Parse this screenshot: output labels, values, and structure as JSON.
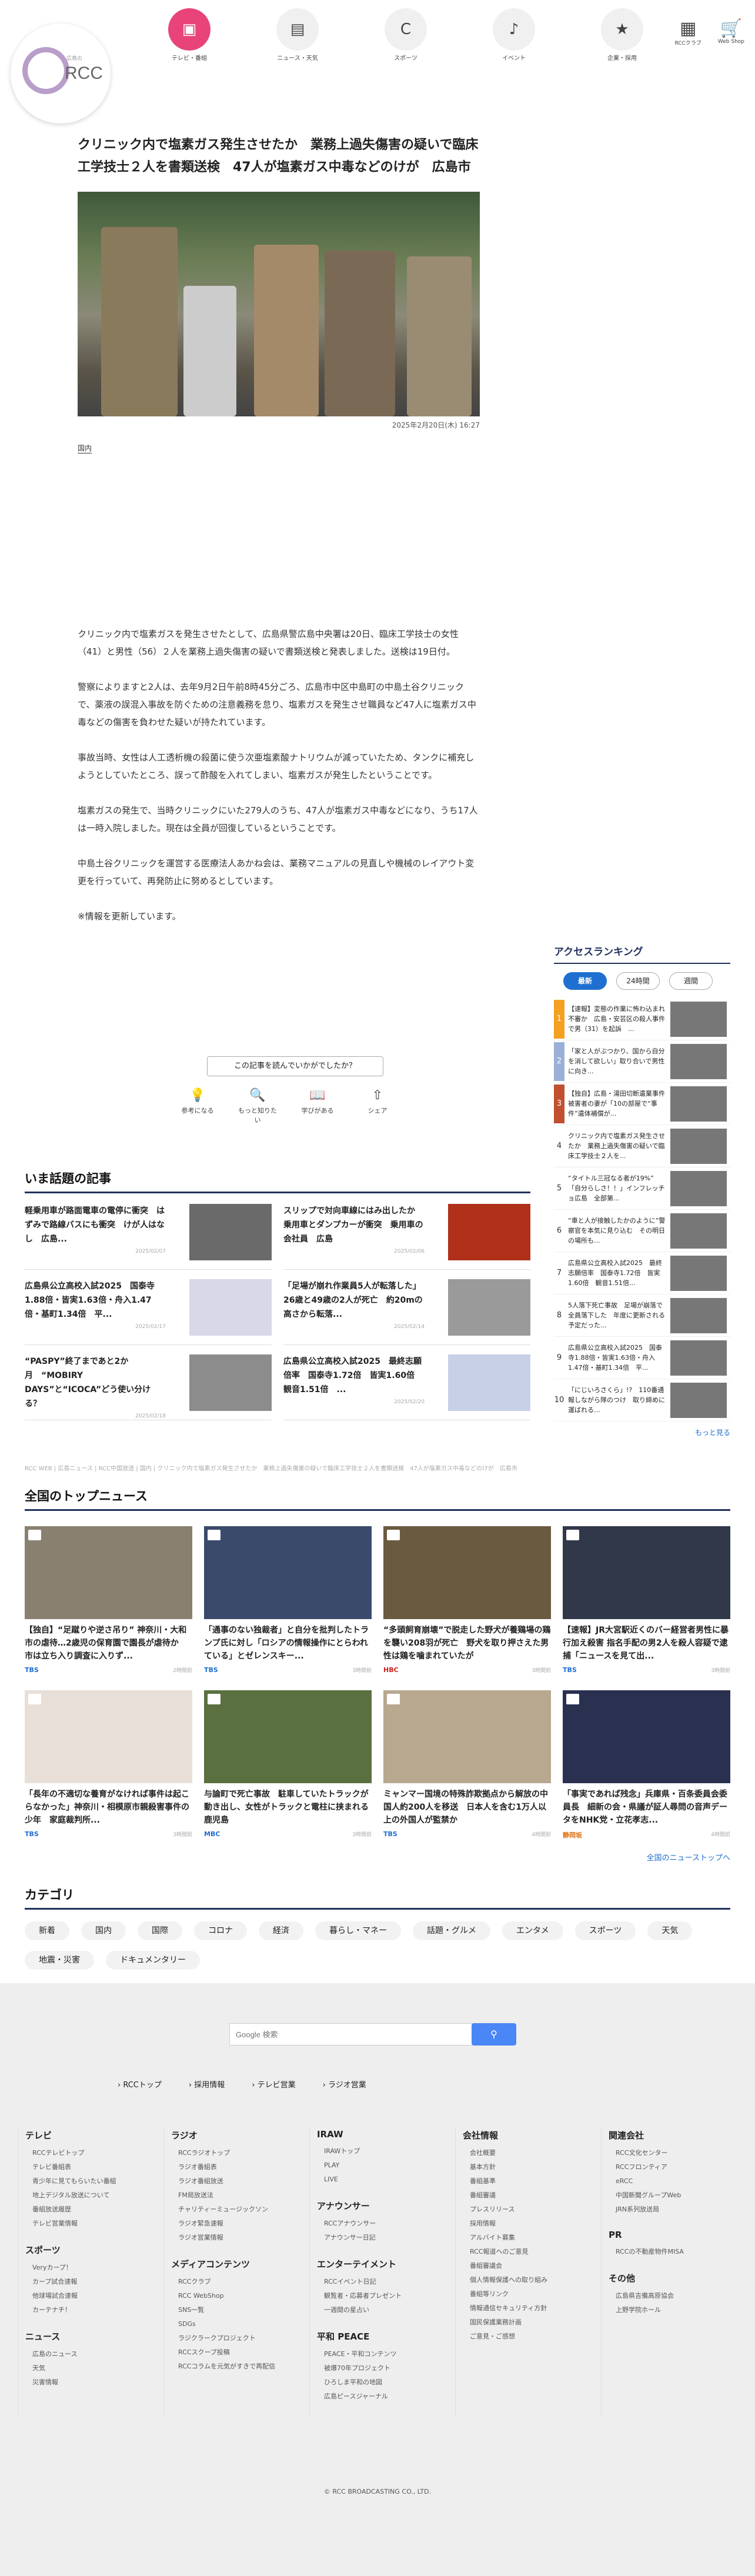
{
  "logo": {
    "sub": "広島の",
    "name": "RCC"
  },
  "nav": [
    {
      "label": "テレビ・番組",
      "icon": "tv-icon",
      "g": "▣"
    },
    {
      "label": "ニュース・天気",
      "icon": "news-icon",
      "g": "▤"
    },
    {
      "label": "スポーツ",
      "icon": "carp-icon",
      "g": "C"
    },
    {
      "label": "イベント",
      "icon": "music-note-icon",
      "g": "♪"
    },
    {
      "label": "企業・採用",
      "icon": "star-icon",
      "g": "★"
    }
  ],
  "util": [
    {
      "label": "RCCクラブ",
      "icon": "grid-icon",
      "g": "▦"
    },
    {
      "label": "Web Shop",
      "icon": "cart-icon",
      "g": "🛒"
    }
  ],
  "article": {
    "title": "クリニック内で塩素ガス発生させたか　業務上過失傷害の疑いで臨床工学技士２人を書類送検　47人が塩素ガス中毒などのけが　広島市",
    "date": "2025年2月20日(木) 16:27",
    "category": "国内",
    "paragraphs": [
      "クリニック内で塩素ガスを発生させたとして、広島県警広島中央署は20日、臨床工学技士の女性（41）と男性（56）２人を業務上過失傷害の疑いで書類送検と発表しました。送検は19日付。",
      "警察によりますと2人は、去年9月2日午前8時45分ごろ、広島市中区中島町の中島土谷クリニックで、薬液の誤混入事故を防ぐための注意義務を怠り、塩素ガスを発生させ職員など47人に塩素ガス中毒などの傷害を負わせた疑いが持たれています。",
      "事故当時、女性は人工透析機の殺菌に使う次亜塩素酸ナトリウムが減っていたため、タンクに補充しようとしていたところ、誤って酢酸を入れてしまい、塩素ガスが発生したということです。",
      "塩素ガスの発生で、当時クリニックにいた279人のうち、47人が塩素ガス中毒などになり、うち17人は一時入院しました。現在は全員が回復しているということです。",
      "中島土谷クリニックを運営する医療法人あかね会は、業務マニュアルの見直しや機械のレイアウト変更を行っていて、再発防止に努めるとしています。",
      "※情報を更新しています。"
    ],
    "ask": "この記事を読んでいかがでしたか？",
    "reactions": [
      {
        "label": "参考になる",
        "g": "💡"
      },
      {
        "label": "もっと知りたい",
        "g": "🔍"
      },
      {
        "label": "学びがある",
        "g": "📖"
      },
      {
        "label": "シェア",
        "g": "⇧"
      }
    ]
  },
  "wadai": {
    "title": "いま話題の記事",
    "items": [
      {
        "title": "軽乗用車が路面電車の電停に衝突　はずみで路線バスにも衝突　けが人はなし　広島...",
        "date": "2025/02/07"
      },
      {
        "title": "スリップで対向車線にはみ出したか　乗用車とダンプカーが衝突　乗用車の会社員　広島",
        "date": "2025/02/06"
      },
      {
        "title": "広島県公立高校入試2025　国泰寺1.88倍・皆実1.63倍・舟入1.47倍・基町1.34倍　平...",
        "date": "2025/02/17"
      },
      {
        "title": "「足場が崩れ作業員5人が転落した」26歳と49歳の2人が死亡　約20mの高さから転落...",
        "date": "2025/02/14"
      },
      {
        "title": "“PASPY”終了まであと2か月　“MOBIRY DAYS”と“ICOCA”どう使い分ける？",
        "date": "2025/02/18"
      },
      {
        "title": "広島県公立高校入試2025　最終志願倍率　国泰寺1.72倍　皆実1.60倍　観音1.51倍　...",
        "date": "2025/02/20"
      }
    ]
  },
  "crumb": "RCC WEB | 広島ニュース | RCC中国放送 | 国内 | クリニック内で塩素ガス発生させたか　業務上過失傷害の疑いで臨床工学技士２人を書類送検　47人が塩素ガス中毒などのけが　広島市",
  "ranking": {
    "title": "アクセスランキング",
    "tabs": [
      "最新",
      "24時間",
      "週間"
    ],
    "items": [
      {
        "n": "1",
        "title": "【速報】変態の作業に怖わ込まれ不審か　広島・安芸区の殺人事件で男（31）を起訴　..."
      },
      {
        "n": "2",
        "title": "「家と人がぶつかり、国から自分を消して欲しい」取り合いで男性に向き..."
      },
      {
        "n": "3",
        "title": "【独自】広島・湯田切断遺棄事件　被害者の妻が「10の部屋で“事件”遺体補償が..."
      },
      {
        "n": "4",
        "title": "クリニック内で塩素ガス発生させたか　業務上過失傷害の疑いで臨床工学技士２人を..."
      },
      {
        "n": "5",
        "title": "“タイトル三冠なる者が19%” 「自分らしさ！！」インフレッチョ広島　全部第..."
      },
      {
        "n": "6",
        "title": "“車と人が接触したかのように”警察官を本気に見り込む　その明日の場所も..."
      },
      {
        "n": "7",
        "title": "広島県公立高校入試2025　最終志願倍率　国泰寺1.72倍　皆実1.60倍　観音1.51倍..."
      },
      {
        "n": "8",
        "title": "5人落下死亡事故　足場が崩落で全員落下した　年度に更新される予定だった..."
      },
      {
        "n": "9",
        "title": "広島県公立高校入試2025　国泰寺1.88倍・皆実1.63倍・舟入1.47倍・基町1.34倍　平..."
      },
      {
        "n": "10",
        "title": "「にじいろさくら」!?　110番通報しながら隊のつけ　取り締めに運ばれる..."
      }
    ],
    "more": "もっと見る"
  },
  "top": {
    "title": "全国のトップニュース",
    "items": [
      {
        "title": "【独自】“足蹴りや逆さ吊り” 神奈川・大和市の虐待…2歳児の保育園で園長が虐待か　市は立ち入り調査に入りず...",
        "src": "TBS",
        "date": "2時間前"
      },
      {
        "title": "「通事のない独裁者」と自分を批判したトランプ氏に対し「ロシアの情報操作にとらわれている」とゼレンスキー...",
        "src": "TBS",
        "date": "3時間前"
      },
      {
        "title": "“多頭飼育崩壊”で脱走した野犬が養鶏場の鶏を襲い208羽が死亡　野犬を取り押さえた男性は鶏を噛まれていたが",
        "src": "HBC",
        "date": "3時間前"
      },
      {
        "title": "【速報】JR大宮駅近くのバー経営者男性に暴行加え殺害 指名手配の男2人を殺人容疑で逮捕「ニュースを見て出...",
        "src": "TBS",
        "date": "3時間前"
      },
      {
        "title": "「長年の不適切な養育がなければ事件は起こらなかった」神奈川・相模原市親殺害事件の少年　家庭裁判所...",
        "src": "TBS",
        "date": "3時間前"
      },
      {
        "title": "与論町で死亡事故　駐車していたトラックが動き出し、女性がトラックと電柱に挟まれる　鹿児島",
        "src": "MBC",
        "date": "3時間前"
      },
      {
        "title": "ミャンマー国境の特殊詐欺拠点から解放の中国人約200人を移送　日本人を含む1万人以上の外国人が監禁か",
        "src": "TBS",
        "date": "4時間前"
      },
      {
        "title": "「事実であれば残念」兵庫県・百条委員会委員長　細新の会・県議が証人尋問の音声データをNHK党・立花孝志...",
        "src": "静岡坂",
        "date": "4時間前"
      }
    ],
    "more": "全国のニューストップへ"
  },
  "category": {
    "title": "カテゴリ",
    "chips": [
      "新着",
      "国内",
      "国際",
      "コロナ",
      "経済",
      "暮らし・マネー",
      "話題・グルメ",
      "エンタメ",
      "スポーツ",
      "天気",
      "地震・災害",
      "ドキュメンタリー"
    ]
  },
  "footer": {
    "search_placeholder": "Google 検索",
    "links": [
      "RCCトップ",
      "採用情報",
      "テレビ営業",
      "ラジオ営業"
    ],
    "cols": [
      [
        {
          "h": "テレビ",
          "li": [
            "RCCテレビトップ",
            "テレビ番組表",
            "青少年に見てもらいたい番組",
            "地上デジタル放送について",
            "番組放送履歴",
            "テレビ営業情報"
          ]
        },
        {
          "h": "スポーツ",
          "li": [
            "Veryカープ！",
            "カープ試合速報",
            "他球場試合速報",
            "カーテナチ！"
          ]
        },
        {
          "h": "ニュース",
          "li": [
            "広島のニュース",
            "天気",
            "災害情報"
          ]
        }
      ],
      [
        {
          "h": "ラジオ",
          "li": [
            "RCCラジオトップ",
            "ラジオ番組表",
            "ラジオ番組放送",
            "FM局放送法",
            "チャリティーミュージックソン",
            "ラジオ緊急速報",
            "ラジオ営業情報"
          ]
        },
        {
          "h": "メディアコンテンツ",
          "li": [
            "RCCクラブ",
            "RCC WebShop",
            "SNS一覧",
            "SDGs",
            "ラジクラークプロジェクト",
            "RCCスクープ投稿",
            "RCCコラムを元気がすきで再配信"
          ]
        }
      ],
      [
        {
          "h": "IRAW",
          "li": [
            "IRAWトップ",
            "PLAY",
            "LIVE"
          ]
        },
        {
          "h": "アナウンサー",
          "li": [
            "RCCアナウンサー",
            "アナウンサー日記"
          ]
        },
        {
          "h": "エンターテイメント",
          "li": [
            "RCCイベント日記",
            "観覧者・応募者プレゼント",
            "一週間の星占い"
          ]
        },
        {
          "h": "平和 PEACE",
          "li": [
            "PEACE・平和コンテンツ",
            "被爆70年プロジェクト",
            "ひろしま平和の地図",
            "広島ピースジャーナル"
          ]
        }
      ],
      [
        {
          "h": "会社情報",
          "li": [
            "会社概要",
            "基本方針",
            "番組基準",
            "番組審議",
            "プレスリリース",
            "採用情報",
            "アルバイト募集",
            "RCC報道へのご意見",
            "番組審議会",
            "個人情報保護への取り組み",
            "番組等リンク",
            "情報通信セキュリティ方針",
            "国民保護業務計画",
            "ご意見・ご感想"
          ]
        }
      ],
      [
        {
          "h": "関連会社",
          "li": [
            "RCC文化センター",
            "RCCフロンティア",
            "eRCC",
            "中国新聞グループWeb",
            "JRN系列放送局"
          ]
        },
        {
          "h": "PR",
          "li": [
            "RCCの不動産物件MISA"
          ]
        },
        {
          "h": "その他",
          "li": [
            "広島県吉備高原協会",
            "上野学院ホール"
          ]
        }
      ]
    ],
    "copyright": "© RCC BROADCASTING CO., LTD."
  }
}
